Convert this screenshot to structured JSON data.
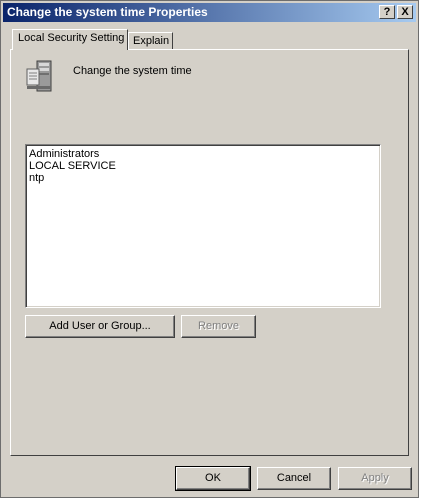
{
  "window": {
    "title": "Change the system time Properties",
    "help_label": "?",
    "close_label": "X"
  },
  "tabs": [
    {
      "label": "Local Security Setting",
      "active": true
    },
    {
      "label": "Explain",
      "active": false
    }
  ],
  "policy": {
    "name": "Change the system time",
    "icon": "server-icon"
  },
  "principals": {
    "items": [
      "Administrators",
      "LOCAL SERVICE",
      "ntp"
    ]
  },
  "actions": {
    "add_label": "Add User or Group...",
    "remove_label": "Remove",
    "remove_enabled": false
  },
  "footer": {
    "ok_label": "OK",
    "cancel_label": "Cancel",
    "apply_label": "Apply",
    "apply_enabled": false
  },
  "colors": {
    "titlebar_start": "#0a246a",
    "titlebar_end": "#a6caf0",
    "face": "#d4d0c8"
  }
}
